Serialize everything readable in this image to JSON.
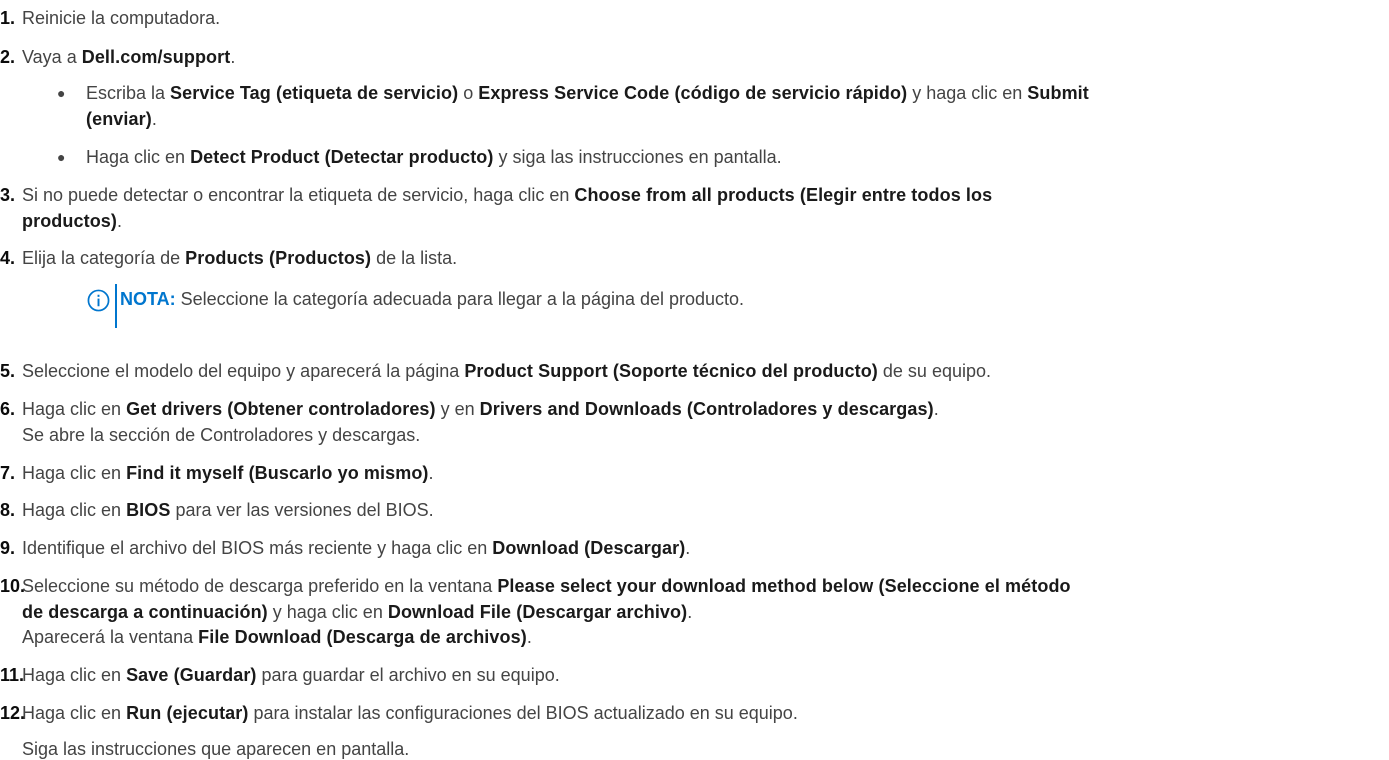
{
  "steps": [
    {
      "num": "1.",
      "parts": [
        "Reinicie la computadora."
      ]
    },
    {
      "num": "2.",
      "pre": "Vaya a ",
      "bold": "Dell.com/support",
      "post": "."
    },
    {
      "num": "3.",
      "l1_pre": "Si no puede detectar o encontrar la etiqueta de servicio, haga clic en ",
      "l1_bold": "Choose from all products (Elegir entre todos los",
      "l2_bold": "productos)",
      "l2_post": "."
    },
    {
      "num": "4.",
      "pre": "Elija la categoría de ",
      "bold": "Products (Productos)",
      "post": " de la lista."
    },
    {
      "num": "5.",
      "pre": "Seleccione el modelo del equipo y aparecerá la página ",
      "bold": "Product Support (Soporte técnico del producto)",
      "post": " de su equipo."
    },
    {
      "num": "6.",
      "pre": "Haga clic en ",
      "bold": "Get drivers (Obtener controladores)",
      "mid": " y en ",
      "bold2": "Drivers and Downloads (Controladores y descargas)",
      "post": ".",
      "line2": "Se abre la sección de Controladores y descargas."
    },
    {
      "num": "7.",
      "pre": "Haga clic en ",
      "bold": "Find it myself (Buscarlo yo mismo)",
      "post": "."
    },
    {
      "num": "8.",
      "pre": "Haga clic en ",
      "bold": "BIOS",
      "post": " para ver las versiones del BIOS."
    },
    {
      "num": "9.",
      "pre": "Identifique el archivo del BIOS más reciente y haga clic en ",
      "bold": "Download (Descargar)",
      "post": "."
    },
    {
      "num": "10.",
      "pre": "Seleccione su método de descarga preferido en la ventana ",
      "bold": "Please select your download method below (Seleccione el método",
      "l2_bold": "de descarga a continuación)",
      "l2_mid": " y haga clic en ",
      "l2_bold2": "Download File (Descargar archivo)",
      "l2_post": ".",
      "l3_pre": "Aparecerá la ventana ",
      "l3_bold": "File Download (Descarga de archivos)",
      "l3_post": "."
    },
    {
      "num": "11.",
      "pre": "Haga clic en ",
      "bold": "Save (Guardar)",
      "post": " para guardar el archivo en su equipo."
    },
    {
      "num": "12.",
      "pre": "Haga clic en ",
      "bold": "Run (ejecutar)",
      "post": " para instalar las configuraciones del BIOS actualizado en su equipo.",
      "line2": "Siga las instrucciones que aparecen en pantalla."
    }
  ],
  "substeps": [
    {
      "bullet": "●",
      "pre": "Escriba la ",
      "bold": "Service Tag (etiqueta de servicio)",
      "mid": " o ",
      "bold2": "Express Service Code (código de servicio rápido)",
      "mid2": " y haga clic en ",
      "bold3": "Submit",
      "l2_bold": "(enviar)",
      "l2_post": "."
    },
    {
      "bullet": "●",
      "pre": "Haga clic en ",
      "bold": "Detect Product (Detectar producto)",
      "post": " y siga las instrucciones en pantalla."
    }
  ],
  "note": {
    "label": "NOTA:",
    "text": " Seleccione la categoría adecuada para llegar a la página del producto."
  },
  "colors": {
    "accent": "#0076ce",
    "text": "#444444",
    "bold": "#1a1a1a"
  }
}
